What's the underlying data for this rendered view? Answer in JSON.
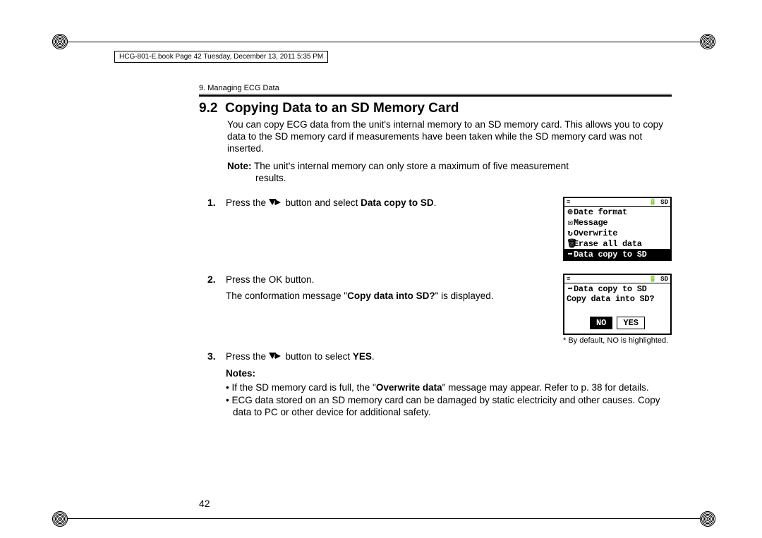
{
  "bookline": "HCG-801-E.book  Page 42  Tuesday, December 13, 2011  5:35 PM",
  "chapter_running": "9. Managing ECG Data",
  "section_number": "9.2",
  "section_title": "Copying Data to an SD Memory Card",
  "intro": "You can copy ECG data from the unit's internal memory to an SD memory card. This allows you to copy data to the SD memory card if measurements have been taken while the SD memory card was not inserted.",
  "note_label": "Note:",
  "note_text": "The unit's internal memory can only store a maximum of five measurement",
  "note_text2": "results.",
  "steps": {
    "s1": {
      "n": "1.",
      "a": "Press the ",
      "b": " button and select ",
      "bold": "Data copy to SD",
      "end": "."
    },
    "s2": {
      "n": "2.",
      "a": "Press the OK button.",
      "b_pre": "The conformation message \"",
      "b_bold": "Copy data into SD?",
      "b_post": "\" is displayed."
    },
    "s3": {
      "n": "3.",
      "a": "Press the ",
      "b": " button to select ",
      "bold": "YES",
      "end": "."
    }
  },
  "notes_header": "Notes:",
  "bullets": {
    "b1_a": "If the SD memory card is full, the \"",
    "b1_bold": "Overwrite data",
    "b1_b": "\" message may appear. Refer to p. 38 for details.",
    "b2": "ECG data stored on an SD memory card can be damaged by static electricity and other causes. Copy data to PC or other device for additional safety."
  },
  "lcd1_top_left": "≡",
  "lcd1_top_right": "🔋 SD",
  "lcd1": {
    "l1": {
      "icon": "⊕",
      "t": "Date format"
    },
    "l2": {
      "icon": "✉",
      "t": "Message"
    },
    "l3": {
      "icon": "↻",
      "t": "Overwrite"
    },
    "l4": {
      "icon": "🗑",
      "t": "Erase all data"
    },
    "l5": {
      "icon": "➡",
      "t": "Data copy to SD"
    }
  },
  "lcd2": {
    "l1": {
      "icon": "➡",
      "t": "Data copy to SD"
    },
    "l2": "Copy data into SD?",
    "no": "NO",
    "yes": "YES"
  },
  "caption": "* By default, NO is highlighted.",
  "page_number": "42"
}
